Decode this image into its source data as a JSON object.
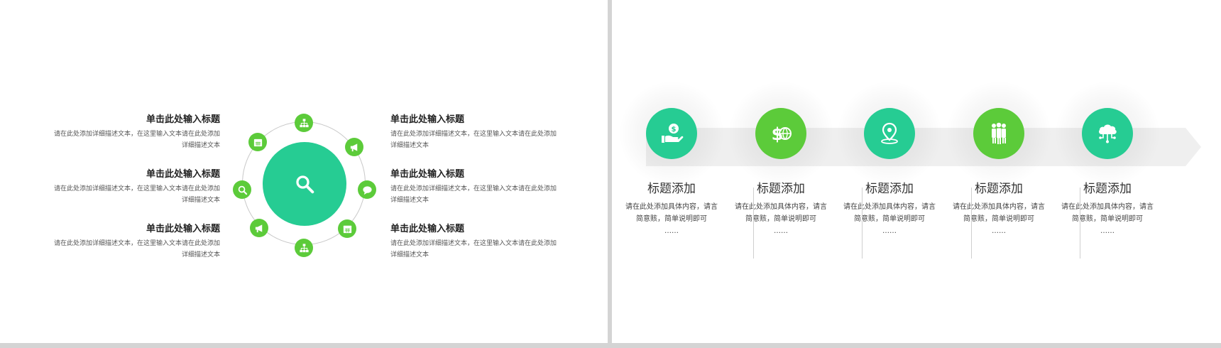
{
  "colors": {
    "teal": "#26cc93",
    "green": "#5ccb3a",
    "band": "#efefef"
  },
  "left_slide": {
    "center_icon": "search-icon",
    "satellite_icons": [
      "org-chart-icon",
      "megaphone-icon",
      "chat-bubble-icon",
      "calendar-icon",
      "org-chart-icon",
      "megaphone-icon",
      "search-icon",
      "calendar-icon"
    ],
    "left_items": [
      {
        "title": "单击此处输入标题",
        "desc_line1": "请在此处添加详细描述文本，在这里输入文本请在此处添加",
        "desc_line2": "详细描述文本"
      },
      {
        "title": "单击此处输入标题",
        "desc_line1": "请在此处添加详细描述文本，在这里输入文本请在此处添加",
        "desc_line2": "详细描述文本"
      },
      {
        "title": "单击此处输入标题",
        "desc_line1": "请在此处添加详细描述文本，在这里输入文本请在此处添加",
        "desc_line2": "详细描述文本"
      }
    ],
    "right_items": [
      {
        "title": "单击此处输入标题",
        "desc_line1": "请在此处添加详细描述文本，在这里输入文本请在此处添加",
        "desc_line2": "详细描述文本"
      },
      {
        "title": "单击此处输入标题",
        "desc_line1": "请在此处添加详细描述文本，在这里输入文本请在此处添加",
        "desc_line2": "详细描述文本"
      },
      {
        "title": "单击此处输入标题",
        "desc_line1": "请在此处添加详细描述文本，在这里输入文本请在此处添加",
        "desc_line2": "详细描述文本"
      }
    ]
  },
  "right_slide": {
    "steps": [
      {
        "icon": "hand-dollar-icon",
        "color": "#26cc93",
        "title": "标题添加",
        "desc_line1": "请在此处添加具体内容，请言",
        "desc_line2": "简意赅，简单说明即可",
        "desc_line3": "……"
      },
      {
        "icon": "dollar-globe-icon",
        "color": "#5ccb3a",
        "title": "标题添加",
        "desc_line1": "请在此处添加具体内容，请言",
        "desc_line2": "简意赅，简单说明即可",
        "desc_line3": "……"
      },
      {
        "icon": "location-pin-icon",
        "color": "#26cc93",
        "title": "标题添加",
        "desc_line1": "请在此处添加具体内容，请言",
        "desc_line2": "简意赅，简单说明即可",
        "desc_line3": "……"
      },
      {
        "icon": "team-icon",
        "color": "#5ccb3a",
        "title": "标题添加",
        "desc_line1": "请在此处添加具体内容，请言",
        "desc_line2": "简意赅，简单说明即可",
        "desc_line3": "……"
      },
      {
        "icon": "cloud-network-icon",
        "color": "#26cc93",
        "title": "标题添加",
        "desc_line1": "请在此处添加具体内容，请言",
        "desc_line2": "简意赅，简单说明即可",
        "desc_line3": "……"
      }
    ]
  }
}
